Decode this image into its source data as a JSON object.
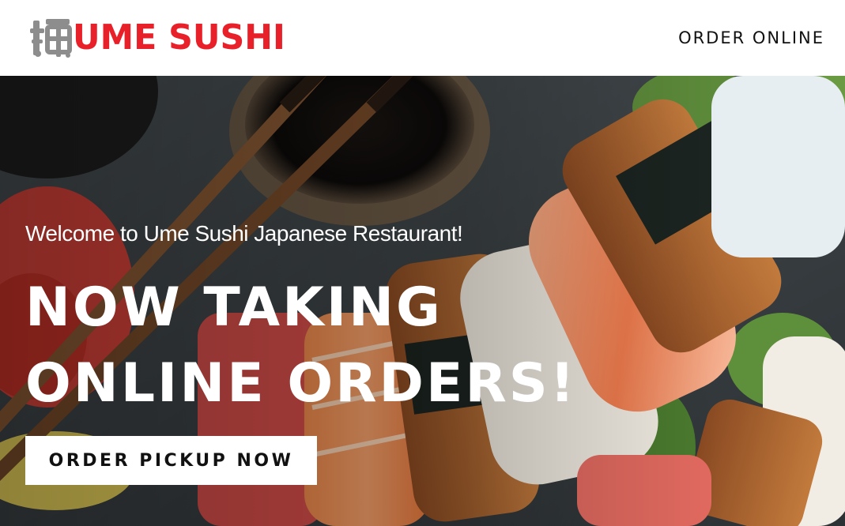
{
  "header": {
    "logo_text": "UME SUSHI",
    "logo_icon": "ume-kanji-icon",
    "nav": {
      "order_online": "ORDER ONLINE"
    }
  },
  "hero": {
    "welcome": "Welcome to Ume Sushi Japanese Restaurant!",
    "headline_line1": "NOW TAKING",
    "headline_line2": "ONLINE ORDERS!",
    "cta_label": "ORDER PICKUP NOW",
    "background_image": "sushi-platter-photo"
  },
  "colors": {
    "brand_red": "#e8202a",
    "header_bg": "#ffffff",
    "cta_bg": "#ffffff",
    "cta_text": "#111111"
  }
}
